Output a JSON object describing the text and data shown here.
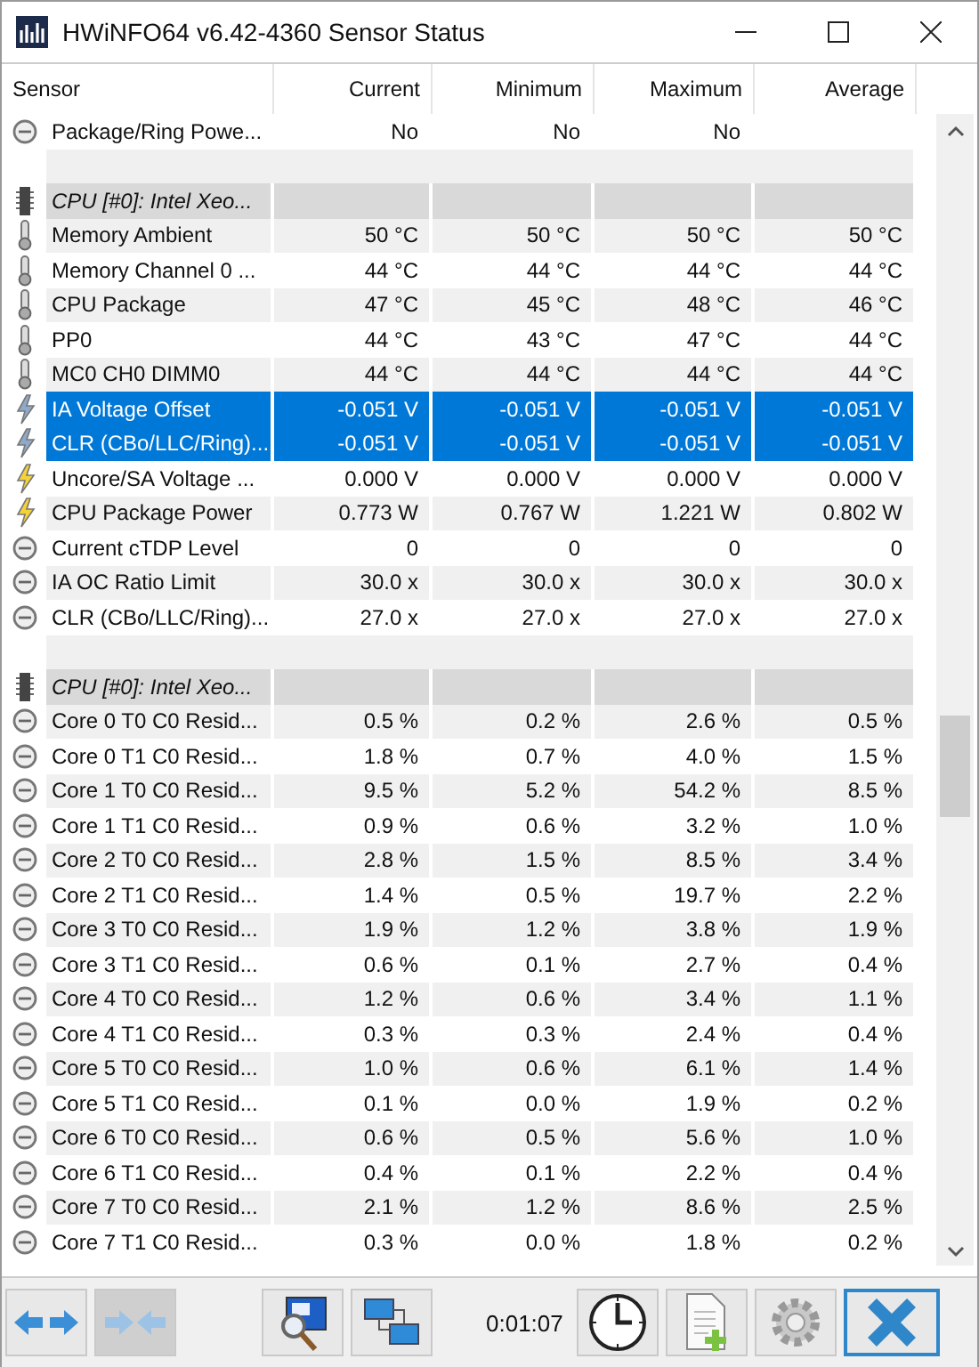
{
  "window": {
    "title": "HWiNFO64 v6.42-4360 Sensor Status"
  },
  "table": {
    "columns": [
      "Sensor",
      "Current",
      "Minimum",
      "Maximum",
      "Average"
    ],
    "rows": [
      {
        "kind": "gauge",
        "name": "Package/Ring Powe...",
        "current": "No",
        "minimum": "No",
        "maximum": "No",
        "selected": false
      },
      {
        "kind": "spacer"
      },
      {
        "kind": "group",
        "name": "CPU [#0]: Intel Xeo..."
      },
      {
        "kind": "temperature",
        "name": "Memory Ambient",
        "current": "50 °C",
        "minimum": "50 °C",
        "maximum": "50 °C",
        "average": "50 °C",
        "selected": false
      },
      {
        "kind": "temperature",
        "name": "Memory Channel 0 ...",
        "current": "44 °C",
        "minimum": "44 °C",
        "maximum": "44 °C",
        "average": "44 °C",
        "selected": false
      },
      {
        "kind": "temperature",
        "name": "CPU Package",
        "current": "47 °C",
        "minimum": "45 °C",
        "maximum": "48 °C",
        "average": "46 °C",
        "selected": false
      },
      {
        "kind": "temperature",
        "name": "PP0",
        "current": "44 °C",
        "minimum": "43 °C",
        "maximum": "47 °C",
        "average": "44 °C",
        "selected": false
      },
      {
        "kind": "temperature",
        "name": "MC0 CH0 DIMM0",
        "current": "44 °C",
        "minimum": "44 °C",
        "maximum": "44 °C",
        "average": "44 °C",
        "selected": false
      },
      {
        "kind": "voltage",
        "name": "IA Voltage Offset",
        "current": "-0.051 V",
        "minimum": "-0.051 V",
        "maximum": "-0.051 V",
        "average": "-0.051 V",
        "selected": true
      },
      {
        "kind": "voltage",
        "name": "CLR (CBo/LLC/Ring)...",
        "current": "-0.051 V",
        "minimum": "-0.051 V",
        "maximum": "-0.051 V",
        "average": "-0.051 V",
        "selected": true
      },
      {
        "kind": "voltage",
        "name": "Uncore/SA Voltage ...",
        "current": "0.000 V",
        "minimum": "0.000 V",
        "maximum": "0.000 V",
        "average": "0.000 V",
        "selected": false
      },
      {
        "kind": "voltage",
        "name": "CPU Package Power",
        "current": "0.773 W",
        "minimum": "0.767 W",
        "maximum": "1.221 W",
        "average": "0.802 W",
        "selected": false
      },
      {
        "kind": "gauge",
        "name": "Current cTDP Level",
        "current": "0",
        "minimum": "0",
        "maximum": "0",
        "average": "0",
        "selected": false
      },
      {
        "kind": "gauge",
        "name": "IA OC Ratio Limit",
        "current": "30.0 x",
        "minimum": "30.0 x",
        "maximum": "30.0 x",
        "average": "30.0 x",
        "selected": false
      },
      {
        "kind": "gauge",
        "name": "CLR (CBo/LLC/Ring)...",
        "current": "27.0 x",
        "minimum": "27.0 x",
        "maximum": "27.0 x",
        "average": "27.0 x",
        "selected": false
      },
      {
        "kind": "spacer"
      },
      {
        "kind": "group",
        "name": "CPU [#0]: Intel Xeo..."
      },
      {
        "kind": "gauge",
        "name": "Core 0 T0 C0 Resid...",
        "current": "0.5 %",
        "minimum": "0.2 %",
        "maximum": "2.6 %",
        "average": "0.5 %",
        "selected": false
      },
      {
        "kind": "gauge",
        "name": "Core 0 T1 C0 Resid...",
        "current": "1.8 %",
        "minimum": "0.7 %",
        "maximum": "4.0 %",
        "average": "1.5 %",
        "selected": false
      },
      {
        "kind": "gauge",
        "name": "Core 1 T0 C0 Resid...",
        "current": "9.5 %",
        "minimum": "5.2 %",
        "maximum": "54.2 %",
        "average": "8.5 %",
        "selected": false
      },
      {
        "kind": "gauge",
        "name": "Core 1 T1 C0 Resid...",
        "current": "0.9 %",
        "minimum": "0.6 %",
        "maximum": "3.2 %",
        "average": "1.0 %",
        "selected": false
      },
      {
        "kind": "gauge",
        "name": "Core 2 T0 C0 Resid...",
        "current": "2.8 %",
        "minimum": "1.5 %",
        "maximum": "8.5 %",
        "average": "3.4 %",
        "selected": false
      },
      {
        "kind": "gauge",
        "name": "Core 2 T1 C0 Resid...",
        "current": "1.4 %",
        "minimum": "0.5 %",
        "maximum": "19.7 %",
        "average": "2.2 %",
        "selected": false
      },
      {
        "kind": "gauge",
        "name": "Core 3 T0 C0 Resid...",
        "current": "1.9 %",
        "minimum": "1.2 %",
        "maximum": "3.8 %",
        "average": "1.9 %",
        "selected": false
      },
      {
        "kind": "gauge",
        "name": "Core 3 T1 C0 Resid...",
        "current": "0.6 %",
        "minimum": "0.1 %",
        "maximum": "2.7 %",
        "average": "0.4 %",
        "selected": false
      },
      {
        "kind": "gauge",
        "name": "Core 4 T0 C0 Resid...",
        "current": "1.2 %",
        "minimum": "0.6 %",
        "maximum": "3.4 %",
        "average": "1.1 %",
        "selected": false
      },
      {
        "kind": "gauge",
        "name": "Core 4 T1 C0 Resid...",
        "current": "0.3 %",
        "minimum": "0.3 %",
        "maximum": "2.4 %",
        "average": "0.4 %",
        "selected": false
      },
      {
        "kind": "gauge",
        "name": "Core 5 T0 C0 Resid...",
        "current": "1.0 %",
        "minimum": "0.6 %",
        "maximum": "6.1 %",
        "average": "1.4 %",
        "selected": false
      },
      {
        "kind": "gauge",
        "name": "Core 5 T1 C0 Resid...",
        "current": "0.1 %",
        "minimum": "0.0 %",
        "maximum": "1.9 %",
        "average": "0.2 %",
        "selected": false
      },
      {
        "kind": "gauge",
        "name": "Core 6 T0 C0 Resid...",
        "current": "0.6 %",
        "minimum": "0.5 %",
        "maximum": "5.6 %",
        "average": "1.0 %",
        "selected": false
      },
      {
        "kind": "gauge",
        "name": "Core 6 T1 C0 Resid...",
        "current": "0.4 %",
        "minimum": "0.1 %",
        "maximum": "2.2 %",
        "average": "0.4 %",
        "selected": false
      },
      {
        "kind": "gauge",
        "name": "Core 7 T0 C0 Resid...",
        "current": "2.1 %",
        "minimum": "1.2 %",
        "maximum": "8.6 %",
        "average": "2.5 %",
        "selected": false
      },
      {
        "kind": "gauge",
        "name": "Core 7 T1 C0 Resid...",
        "current": "0.3 %",
        "minimum": "0.0 %",
        "maximum": "1.8 %",
        "average": "0.2 %",
        "selected": false
      }
    ]
  },
  "toolbar": {
    "buttons": [
      {
        "kind": "expand",
        "pressed": false
      },
      {
        "kind": "collapse",
        "pressed": true
      },
      {
        "kind": "monitor",
        "pressed": false
      },
      {
        "kind": "network",
        "pressed": false
      },
      {
        "kind": "timer",
        "text": "0:01:07"
      },
      {
        "kind": "clock",
        "pressed": false
      },
      {
        "kind": "report",
        "pressed": false
      },
      {
        "kind": "settings",
        "pressed": false
      },
      {
        "kind": "close",
        "pressed": false
      }
    ]
  }
}
